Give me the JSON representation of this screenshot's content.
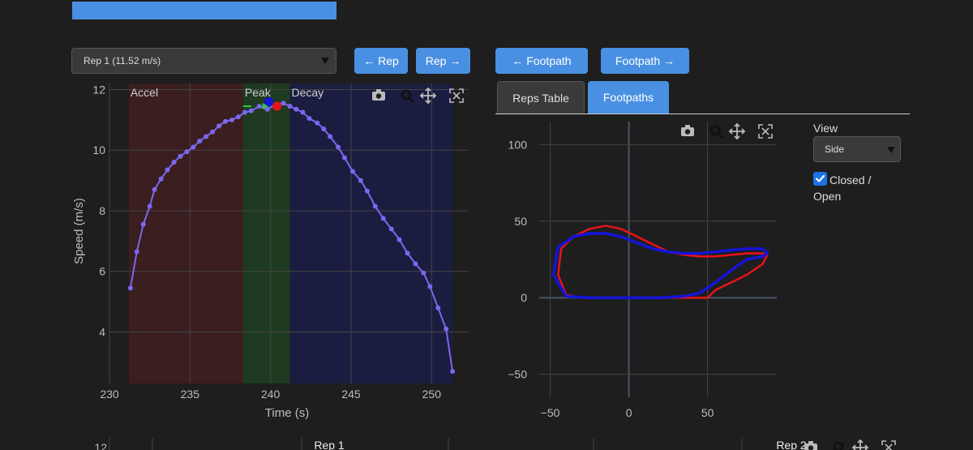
{
  "controls": {
    "rep_select_value": "Rep 1 (11.52 m/s)",
    "prev_rep_label": "← Rep",
    "next_rep_label": "Rep →",
    "prev_footpath_label": "← Footpath",
    "next_footpath_label": "Footpath →"
  },
  "tabs": [
    {
      "label": "Reps Table",
      "active": false
    },
    {
      "label": "Footpaths",
      "active": true
    }
  ],
  "footpath_options": {
    "view_label": "View",
    "view_value": "Side",
    "closed_open_label": "Closed / Open",
    "closed_open_checked": true
  },
  "colors": {
    "accent": "#4a90e2",
    "speed_line": "#7b68ee",
    "accel_band": "#3a1e20",
    "peak_band": "#1e3a21",
    "decay_band": "#1b1d40",
    "path_red": "#e8131b",
    "path_blue": "#1414d8"
  },
  "icons": [
    "camera-icon",
    "zoom-icon",
    "pan-icon",
    "autoscale-icon"
  ],
  "chart_data": [
    {
      "type": "line",
      "xlabel": "Time (s)",
      "ylabel": "Speed (m/s)",
      "xlim": [
        230,
        252.3
      ],
      "ylim": [
        2.3,
        12.2
      ],
      "x_ticks": [
        230,
        235,
        240,
        245,
        250
      ],
      "y_ticks": [
        4,
        6,
        8,
        10,
        12
      ],
      "grid": true,
      "phases": [
        {
          "label": "Accel",
          "x0": 231.2,
          "x1": 238.3
        },
        {
          "label": "Peak",
          "x0": 238.3,
          "x1": 241.2
        },
        {
          "label": "Decay",
          "x0": 241.2,
          "x1": 251.3
        }
      ],
      "series": [
        {
          "x": [
            231.3,
            231.7,
            232.1,
            232.5,
            232.8,
            233.2,
            233.6,
            234.0,
            234.4,
            234.8,
            235.2,
            235.6,
            236.0,
            236.4,
            236.8,
            237.2,
            237.6,
            238.0,
            238.4,
            238.8,
            239.3,
            239.8,
            240.3,
            240.8,
            241.2,
            241.6,
            242.0,
            242.4,
            242.9,
            243.3,
            243.7,
            244.2,
            244.6,
            245.1,
            245.6,
            246.0,
            246.5,
            247.0,
            247.5,
            248.0,
            248.5,
            249.0,
            249.5,
            249.9,
            250.4,
            250.9,
            251.3
          ],
          "y": [
            5.45,
            6.65,
            7.55,
            8.15,
            8.7,
            9.05,
            9.35,
            9.6,
            9.8,
            9.95,
            10.1,
            10.3,
            10.45,
            10.6,
            10.8,
            10.95,
            11.0,
            11.1,
            11.25,
            11.3,
            11.45,
            11.35,
            11.5,
            11.55,
            11.45,
            11.35,
            11.25,
            11.05,
            10.9,
            10.7,
            10.45,
            10.1,
            9.75,
            9.3,
            9.0,
            8.65,
            8.15,
            7.75,
            7.4,
            7.05,
            6.6,
            6.25,
            5.95,
            5.5,
            4.8,
            4.1,
            2.7
          ]
        }
      ],
      "markers": [
        {
          "x": 239.9,
          "y": 11.6,
          "color": "#1414d8"
        },
        {
          "x": 240.4,
          "y": 11.45,
          "color": "#e8131b"
        }
      ],
      "arrow": {
        "x0": 238.3,
        "x1": 239.9,
        "y": 11.45,
        "color": "#2ecc40"
      }
    },
    {
      "type": "line",
      "xlim": [
        -57,
        94
      ],
      "ylim": [
        -65,
        115
      ],
      "x_ticks": [
        -50,
        0,
        50
      ],
      "y_ticks": [
        -50,
        0,
        50,
        100
      ],
      "grid": true,
      "series": [
        {
          "name": "",
          "color": "#e8131b",
          "x": [
            -40,
            -45,
            -43,
            -35,
            -25,
            -15,
            -5,
            5,
            15,
            25,
            35,
            45,
            55,
            65,
            75,
            85,
            88,
            85,
            75,
            65,
            55,
            50,
            45,
            30,
            15,
            0,
            -15,
            -30,
            -40
          ],
          "y": [
            2,
            15,
            32,
            40,
            45,
            47,
            45,
            40,
            35,
            30,
            28,
            27,
            27,
            28,
            29,
            29,
            28,
            22,
            15,
            10,
            5,
            0,
            0,
            0,
            0,
            0,
            0,
            0,
            2
          ]
        },
        {
          "name": "",
          "color": "#1414d8",
          "x": [
            -40,
            -48,
            -45,
            -35,
            -25,
            -15,
            -5,
            5,
            15,
            25,
            35,
            45,
            55,
            65,
            75,
            85,
            88,
            85,
            75,
            65,
            55,
            45,
            35,
            20,
            5,
            -10,
            -25,
            -40
          ],
          "y": [
            1,
            15,
            33,
            40,
            42,
            42,
            40,
            36,
            32,
            30,
            29,
            29,
            30,
            31,
            32,
            32,
            29,
            27,
            25,
            18,
            10,
            3,
            1,
            0,
            0,
            0,
            0,
            1
          ]
        }
      ]
    },
    {
      "type": "line",
      "title": "Rep 1",
      "y_ticks": [
        12
      ]
    },
    {
      "type": "line",
      "title": "Rep 2"
    }
  ]
}
